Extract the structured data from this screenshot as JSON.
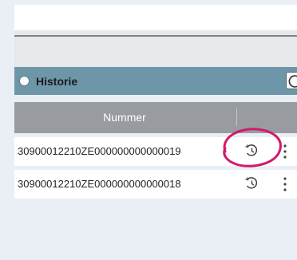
{
  "section": {
    "title": "Historie"
  },
  "table": {
    "column_header": "Nummer",
    "rows": [
      {
        "nummer": "30900012210ZE000000000000019"
      },
      {
        "nummer": "30900012210ZE000000000000018"
      }
    ]
  },
  "icons": {
    "history": "history-icon",
    "more": "more-vertical-icon",
    "radio": "radio-button"
  },
  "colors": {
    "header": "#6e96a9",
    "table_header": "#989ca1",
    "annotation": "#d4196b"
  }
}
